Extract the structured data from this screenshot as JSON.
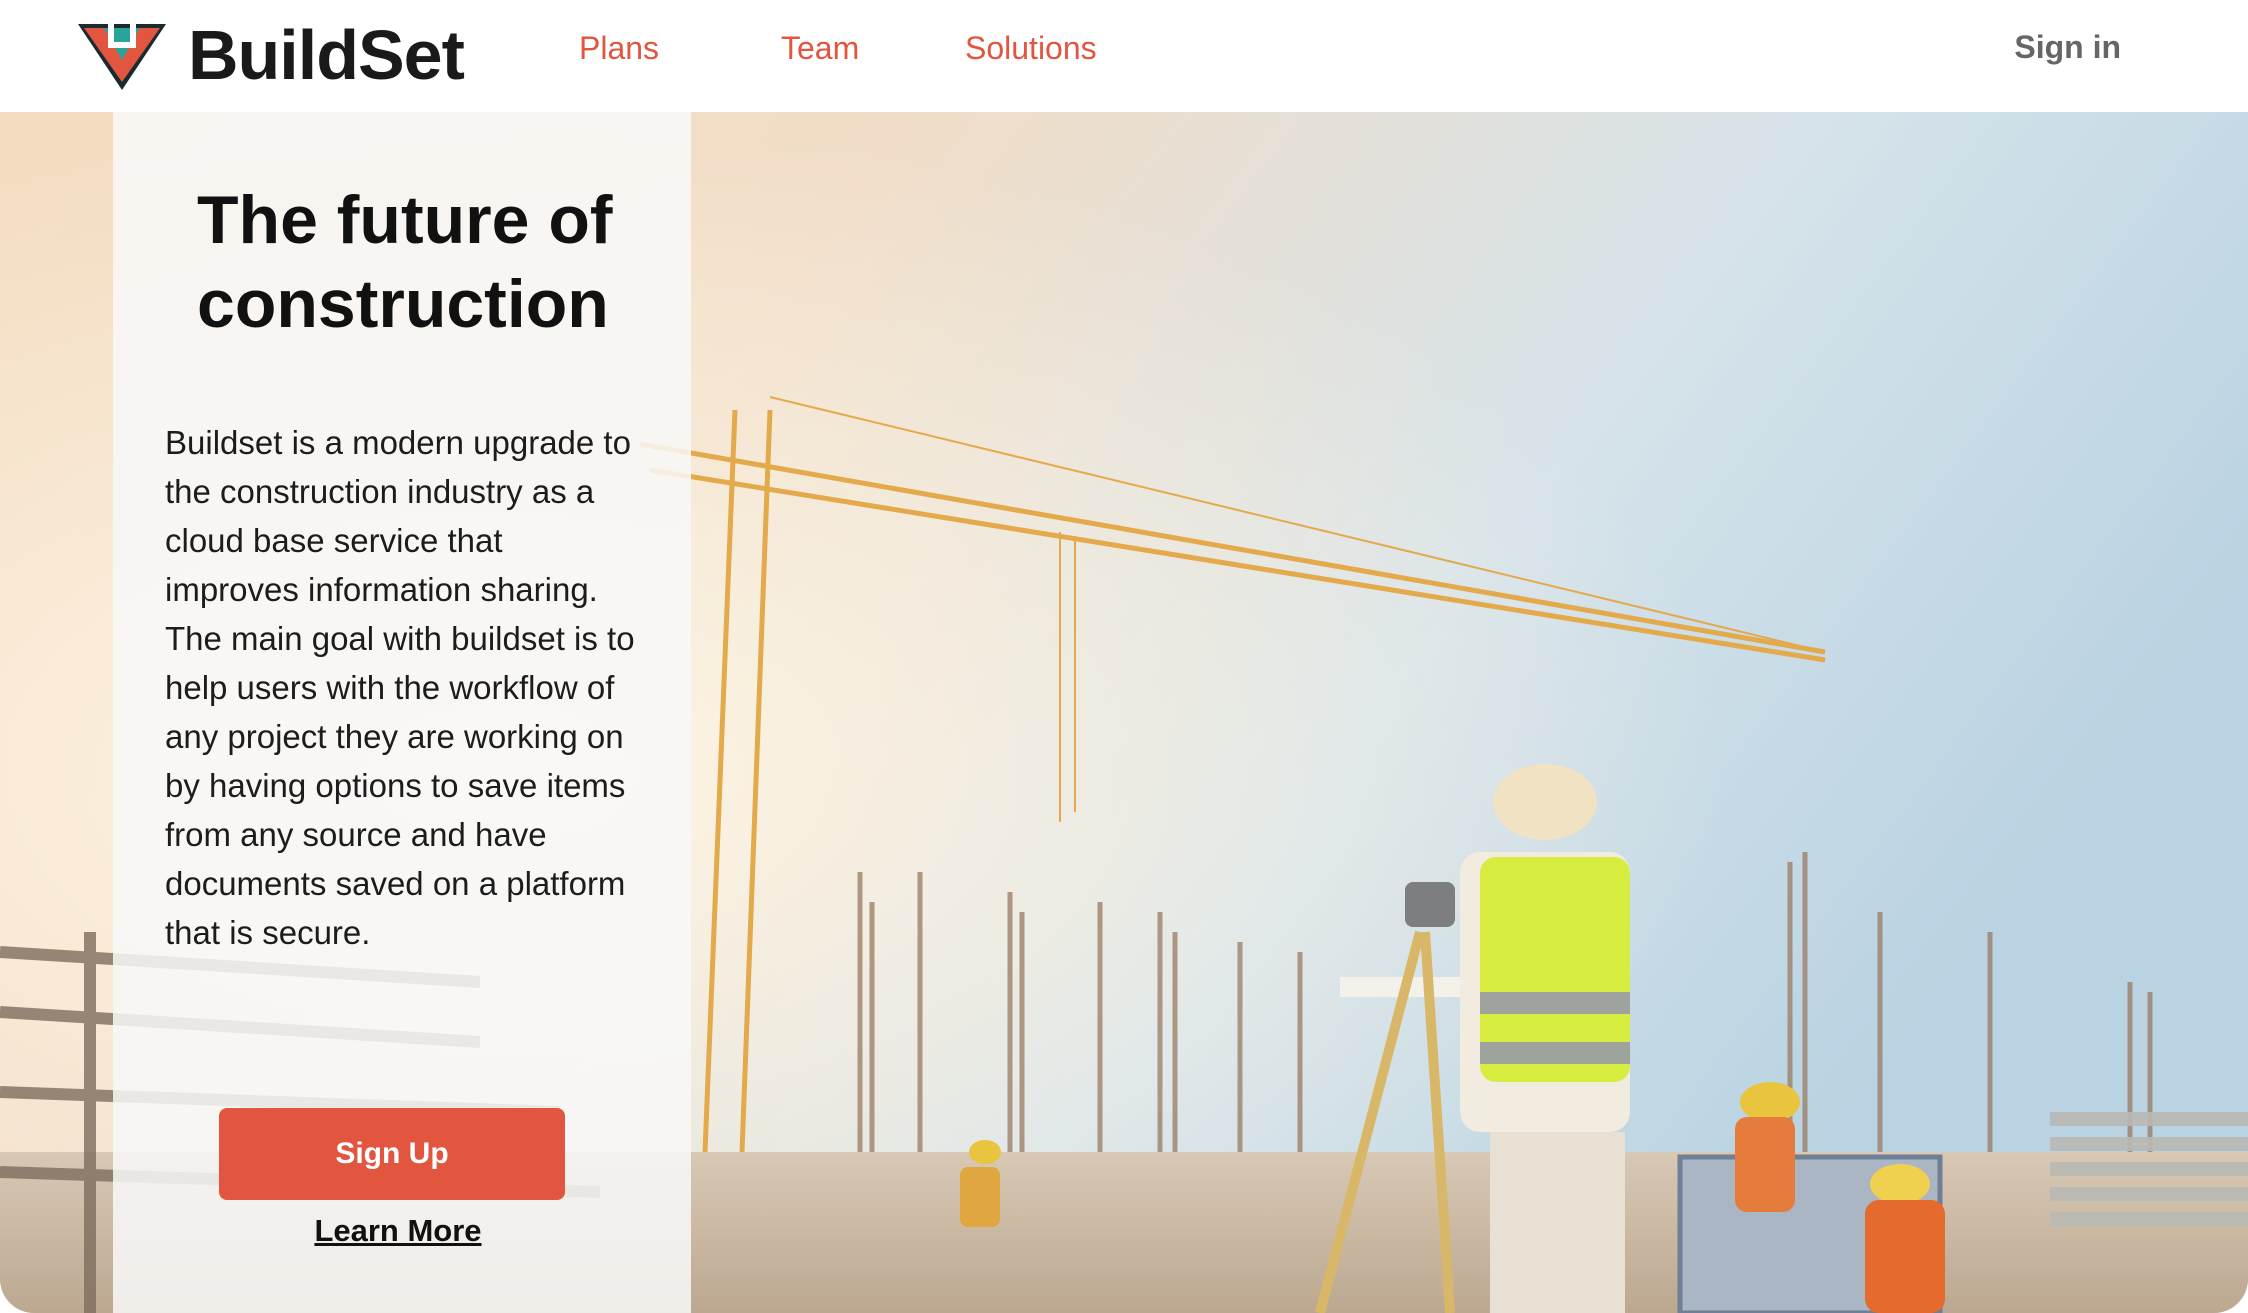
{
  "brand": {
    "name": "BuildSet",
    "logo_icon": "buildset-logo-icon"
  },
  "nav": {
    "items": [
      "Plans",
      "Team",
      "Solutions"
    ],
    "signin": "Sign in",
    "accent": "#e2553f"
  },
  "hero": {
    "headline": "The future of construction",
    "description": "Buildset is a modern upgrade to the construction industry as a cloud base service that improves information sharing. The main goal with buildset is to help users with the workflow of any project they are working on by having options to save items from any source and have documents saved on a platform that is secure.",
    "signup_label": "Sign Up",
    "learn_more_label": "Learn More",
    "background_image": "construction-site-photo"
  }
}
